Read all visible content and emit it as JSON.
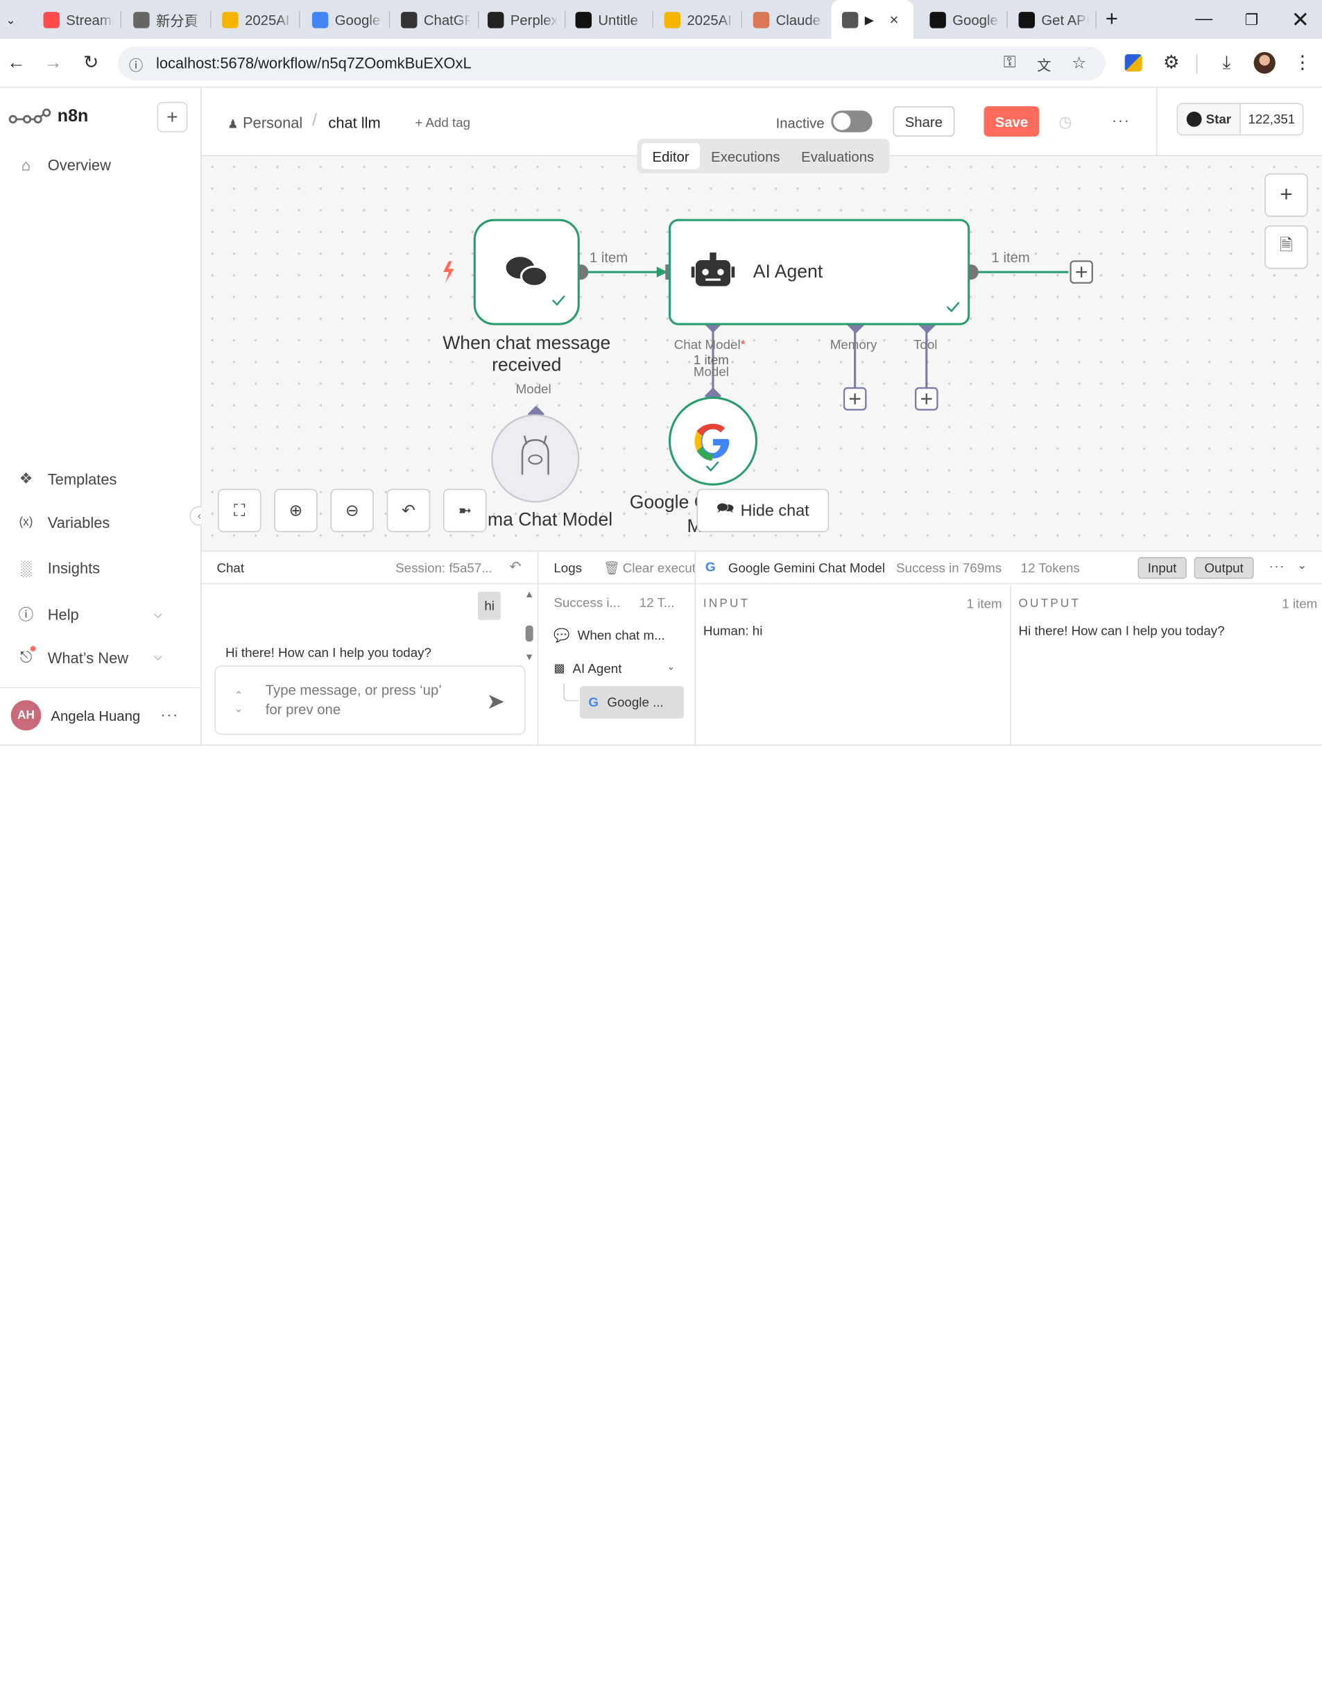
{
  "browser": {
    "tabs": [
      {
        "label": "Streaml",
        "icon": "streamlit-icon",
        "color": "#ff4b4b"
      },
      {
        "label": "新分頁",
        "icon": "chrome-icon",
        "color": "#666666"
      },
      {
        "label": "2025AI",
        "icon": "slides-icon",
        "color": "#f4b400"
      },
      {
        "label": "Google",
        "icon": "gemini-icon",
        "color": "#4285f4"
      },
      {
        "label": "ChatGP",
        "icon": "openai-icon",
        "color": "#333333"
      },
      {
        "label": "Perplex",
        "icon": "perplexity-icon",
        "color": "#222222"
      },
      {
        "label": "Untitle",
        "icon": "untitled-icon",
        "color": "#111111"
      },
      {
        "label": "2025AI",
        "icon": "slides-icon",
        "color": "#f4b400"
      },
      {
        "label": "Claude",
        "icon": "claude-icon",
        "color": "#d97757"
      },
      {
        "label": "",
        "icon": "n8n-icon",
        "color": "#555555"
      },
      {
        "label": "Google",
        "icon": "aistudio-icon",
        "color": "#111111"
      },
      {
        "label": "Get API",
        "icon": "aistudio-icon",
        "color": "#111111"
      }
    ],
    "url": "localhost:5678/workflow/n5q7ZOomkBuEXOxL"
  },
  "sidebar": {
    "logo": "n8n",
    "overview": "Overview",
    "items": [
      "Templates",
      "Variables",
      "Insights",
      "Help",
      "What’s New"
    ],
    "user_initials": "AH",
    "user_name": "Angela Huang"
  },
  "header": {
    "project": "Personal",
    "workflow_name": "chat llm",
    "add_tag": "+ Add tag",
    "status": "Inactive",
    "share": "Share",
    "save": "Save",
    "github_star": "Star",
    "github_count": "122,351",
    "accent": "#ff6d5a"
  },
  "tabs": {
    "editor": "Editor",
    "executions": "Executions",
    "evaluations": "Evaluations"
  },
  "canvas": {
    "trigger_label_1": "When chat message",
    "trigger_label_2": "received",
    "agent_label": "AI Agent",
    "conn_1": "1 item",
    "conn_2": "1 item",
    "conn_3": "1 item",
    "port_chat_model": "Chat Model",
    "port_memory": "Memory",
    "port_tool": "Tool",
    "model_port_1": "Model",
    "model_port_2": "Model",
    "ollama_label": "ma Chat Model",
    "gemini_label_1": "Google G",
    "gemini_label_2": "M",
    "hide_chat": "Hide chat",
    "success_color": "#2a9d6f"
  },
  "chat": {
    "title": "Chat",
    "session": "Session: f5a57...",
    "user_msg": "hi",
    "bot_msg": "Hi there! How can I help you today?",
    "placeholder_1": "Type message, or press ‘up’",
    "placeholder_2": "for prev one"
  },
  "logs": {
    "title": "Logs",
    "clear": "Clear execut",
    "summary": "Success i...",
    "tokens": "12 T...",
    "entries": [
      "When chat m...",
      "AI Agent",
      "Google ..."
    ]
  },
  "detail": {
    "node": "Google Gemini Chat Model",
    "status": "Success in 769ms",
    "tokens": "12 Tokens",
    "input_tab": "Input",
    "output_tab": "Output",
    "input_title": "INPUT",
    "input_count": "1 item",
    "input_text": "Human: hi",
    "output_title": "OUTPUT",
    "output_count": "1 item",
    "output_text": "Hi there! How can I help you today?"
  }
}
